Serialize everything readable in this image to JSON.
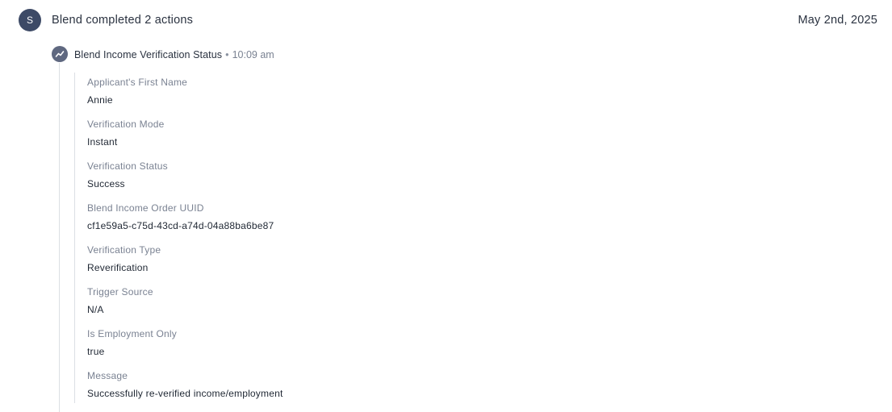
{
  "header": {
    "avatar_letter": "S",
    "title": "Blend completed 2 actions",
    "date": "May 2nd, 2025"
  },
  "action": {
    "icon": "trend-line-icon",
    "title": "Blend Income Verification Status",
    "separator": "•",
    "time": "10:09 am"
  },
  "fields": [
    {
      "label": "Applicant's First Name",
      "value": "Annie"
    },
    {
      "label": "Verification Mode",
      "value": "Instant"
    },
    {
      "label": "Verification Status",
      "value": "Success"
    },
    {
      "label": "Blend Income Order UUID",
      "value": "cf1e59a5-c75d-43cd-a74d-04a88ba6be87"
    },
    {
      "label": "Verification Type",
      "value": "Reverification"
    },
    {
      "label": "Trigger Source",
      "value": "N/A"
    },
    {
      "label": "Is Employment Only",
      "value": "true"
    },
    {
      "label": "Message",
      "value": "Successfully re-verified income/employment"
    }
  ],
  "colors": {
    "avatar_bg": "#3d4a66",
    "action_icon_bg": "#5f6880",
    "label": "#7a8292",
    "text": "#1f2733",
    "divider": "#dcdfe4"
  }
}
